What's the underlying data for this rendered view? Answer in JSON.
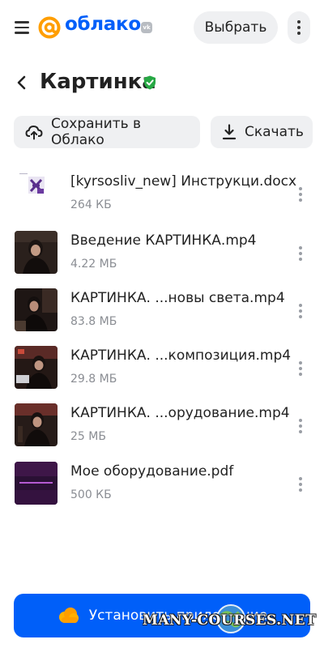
{
  "header": {
    "logo_text": "облако",
    "vk_badge": "vk",
    "select_label": "Выбрать"
  },
  "page": {
    "title": "Картинка"
  },
  "actions": {
    "save_to_cloud": "Сохранить в Облако",
    "download": "Скачать"
  },
  "files": [
    {
      "name": "[kyrsosliv_new] Инструкци.docx",
      "size": "264 КБ",
      "thumb": "doc"
    },
    {
      "name": "Введение КАРТИНКА.mp4",
      "size": "4.22 МБ",
      "thumb": "video-1"
    },
    {
      "name": "КАРТИНКА. ...новы света.mp4",
      "size": "83.8 МБ",
      "thumb": "video-2"
    },
    {
      "name": "КАРТИНКА. ...композиция.mp4",
      "size": "29.8 МБ",
      "thumb": "video-3"
    },
    {
      "name": "КАРТИНКА. ...орудование.mp4",
      "size": "25 МБ",
      "thumb": "video-4"
    },
    {
      "name": "Мое оборудование.pdf",
      "size": "500 КБ",
      "thumb": "pdf"
    }
  ],
  "footer": {
    "install_label": "Установить приложение",
    "watermark": "MANY-COURSES.NET"
  },
  "colors": {
    "brand_blue": "#005ff9",
    "brand_orange": "#ff9e00",
    "verified_green": "#27a844",
    "button_gray": "#eff0f2",
    "muted_text": "#8a8d93"
  },
  "icons": {
    "menu": "hamburger-icon",
    "logo": "at-sign-logo-icon",
    "more": "vertical-dots-icon",
    "back": "chevron-left-icon",
    "verified": "shield-check-icon",
    "cloud_upload": "cloud-upload-icon",
    "download": "download-icon",
    "cloud_app": "cloud-icon"
  }
}
